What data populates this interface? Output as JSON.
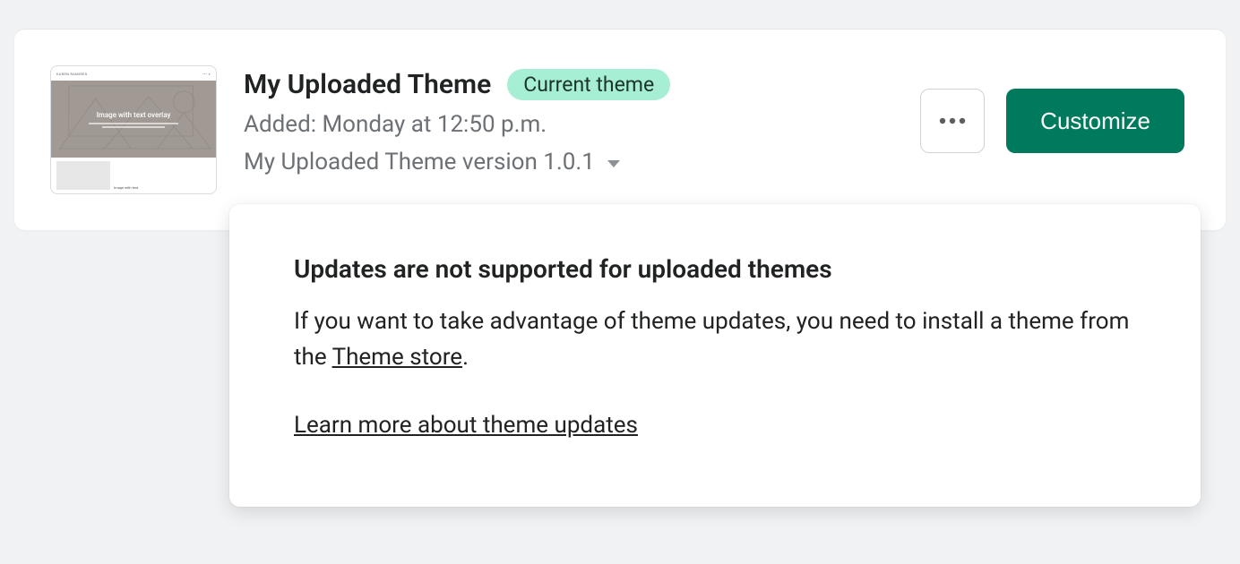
{
  "theme": {
    "title": "My Uploaded Theme",
    "badge": "Current theme",
    "added_prefix": "Added: ",
    "added_value": "Monday at 12:50 p.m.",
    "version_label": "My Uploaded Theme version 1.0.1"
  },
  "thumbnail": {
    "site_name": "KAREN RAMIRES",
    "hero_text": "Image with text overlay",
    "bottom_label": "Image with text"
  },
  "actions": {
    "customize": "Customize",
    "more_aria": "More actions"
  },
  "popover": {
    "heading": "Updates are not supported for uploaded themes",
    "body_prefix": "If you want to take advantage of theme updates, you need to install a theme from the ",
    "body_link": "Theme store",
    "body_suffix": ".",
    "learn_link": "Learn more about theme updates"
  }
}
